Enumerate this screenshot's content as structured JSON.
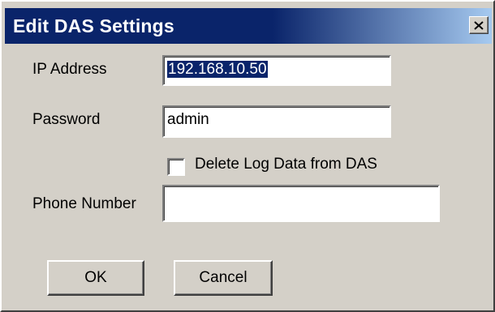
{
  "window": {
    "title": "Edit DAS Settings",
    "close_icon": "close-icon"
  },
  "form": {
    "ip_label": "IP Address",
    "ip_value": "192.168.10.50",
    "password_label": "Password",
    "password_value": "admin",
    "delete_log_label": "Delete Log Data from DAS",
    "delete_log_checked": false,
    "phone_label": "Phone Number",
    "phone_value": ""
  },
  "buttons": {
    "ok_label": "OK",
    "cancel_label": "Cancel"
  },
  "colors": {
    "titlebar": "#0a246a",
    "dialog_bg": "#d4d0c8",
    "selection": "#0a246a"
  }
}
